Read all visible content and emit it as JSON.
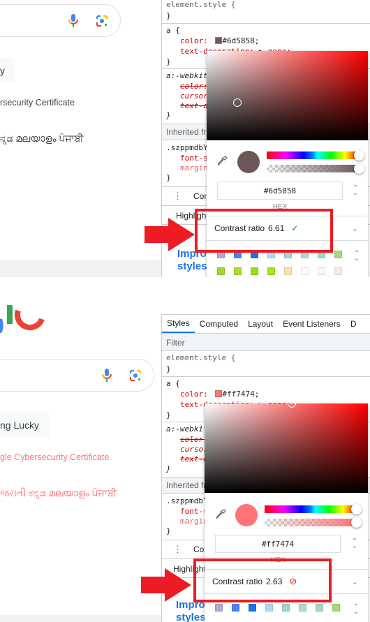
{
  "top": {
    "google": {
      "lucky_button_fragment": "y",
      "certificate_link": "rsecurity Certificate",
      "languages": "ನ್ನಡ  മലയാളം  ਪੰਜਾਬੀ",
      "link_color": "#6d5858"
    },
    "styles": {
      "element_style_open": "element.style {",
      "close_brace": "}",
      "rule_a_selector": "a {",
      "rule_a_color_prop": "color:",
      "rule_a_color_value": "#6d5858;",
      "rule_a_text_dec": "text-decoration: ▶ none;",
      "webkit_selector": "a:-webkit",
      "webkit_color": "color:",
      "webkit_cursor": "cursor",
      "webkit_text": "text-d",
      "inherited_label": "Inherited fr",
      "class_selector": ".szppmdbY",
      "font_size_prop": "font-s",
      "margin_prop": "margin",
      "console_label": "Cons",
      "highlight_label": "Highlight",
      "improve_line1": "Impro",
      "improve_line2": "styles"
    },
    "picker": {
      "hex_value": "#6d5858",
      "hex_label": "HEX",
      "color": "#6d5858",
      "hue_color": "#ff0000",
      "contrast_label": "Contrast ratio",
      "contrast_value": "6.61",
      "contrast_status": "pass",
      "contrast_icon": "✓",
      "contrast_icon_color": "#188038"
    }
  },
  "bottom": {
    "google": {
      "lucky_button_fragment": "ng Lucky",
      "certificate_link": "gle Cybersecurity Certificate",
      "languages": "જરાતી  ಕನ್ನಡ  മലയാളം  ਪੰਜਾਬੀ",
      "link_color": "#ff7474"
    },
    "devtools_tabs": [
      "Styles",
      "Computed",
      "Layout",
      "Event Listeners",
      "D"
    ],
    "active_tab": "Styles",
    "filter_placeholder": "Filter",
    "styles": {
      "element_style_open": "element.style {",
      "close_brace": "}",
      "rule_a_selector": "a {",
      "rule_a_color_prop": "color:",
      "rule_a_color_value": "#ff7474;",
      "rule_a_text_dec": "text-decoration: ▶ none;",
      "webkit_selector": "a:-webkit",
      "webkit_color": "color:",
      "webkit_cursor": "cursor",
      "webkit_text": "text-d",
      "inherited_label": "Inherited fr",
      "class_selector": ".szppmdbY",
      "font_size_prop": "font-s",
      "margin_prop": "margin",
      "console_label": "Cons",
      "highlight_label": "Highlight",
      "improve_line1": "Impro",
      "improve_line2": "styles"
    },
    "picker": {
      "hex_value": "#ff7474",
      "hex_label": "HEX",
      "color": "#ff7474",
      "hue_color": "#ff0000",
      "contrast_label": "Contrast ratio",
      "contrast_value": "2.63",
      "contrast_status": "fail",
      "contrast_icon": "⊘",
      "contrast_icon_color": "#d93025"
    }
  },
  "palette": {
    "row1": [
      "#b4a7d6",
      "#4285f4",
      "#1a73e8",
      "#a8dafc",
      "#a0d8d0",
      "#a8dcd0",
      "#a0d8c0",
      "#a8dc70"
    ],
    "row2": [
      "#a0d830",
      "#a8dc30",
      "#98dc20",
      "#a0e820",
      "#ffe0b0",
      "#ffffff",
      "#f8f9fa",
      "#eeeeee"
    ]
  },
  "annotation_color": "#ed1c24"
}
